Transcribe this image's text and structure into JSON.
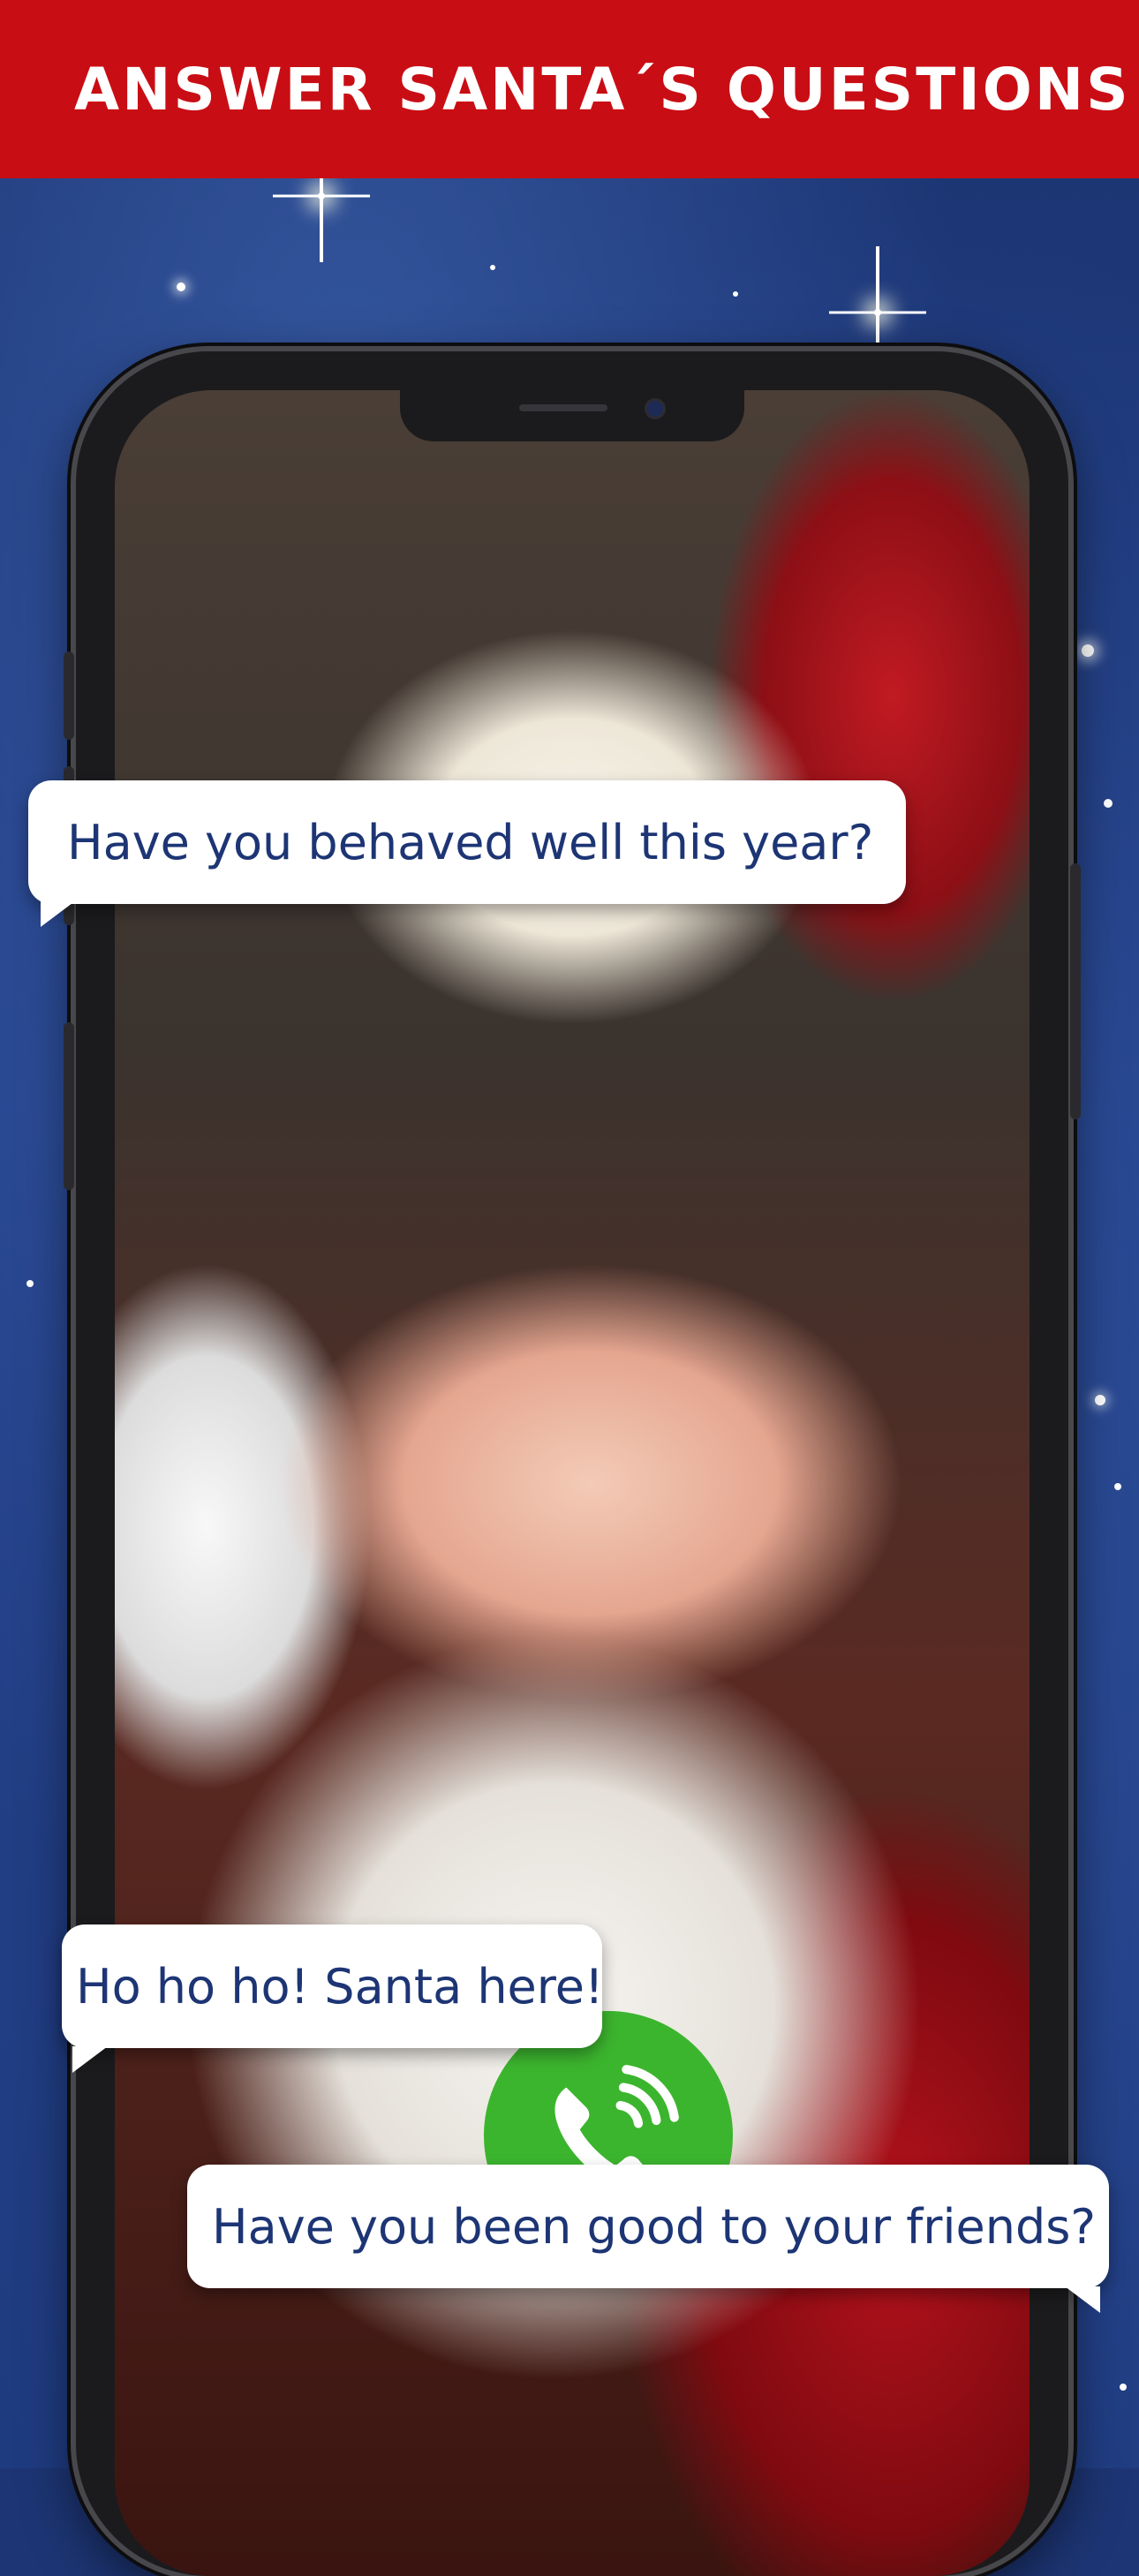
{
  "header": {
    "title": "ANSWER SANTA´S QUESTIONS",
    "background_color": "#c90d14",
    "text_color": "#ffffff"
  },
  "background": {
    "color": "#1d3574"
  },
  "bubbles": [
    {
      "text": "Have you behaved well this year?"
    },
    {
      "text": "Ho ho ho! Santa here!"
    },
    {
      "text": "Have you been good to your friends?"
    }
  ],
  "call_button": {
    "icon": "phone-ringing-icon",
    "color": "#3cb52e"
  },
  "bubble_text_color": "#1d3574"
}
